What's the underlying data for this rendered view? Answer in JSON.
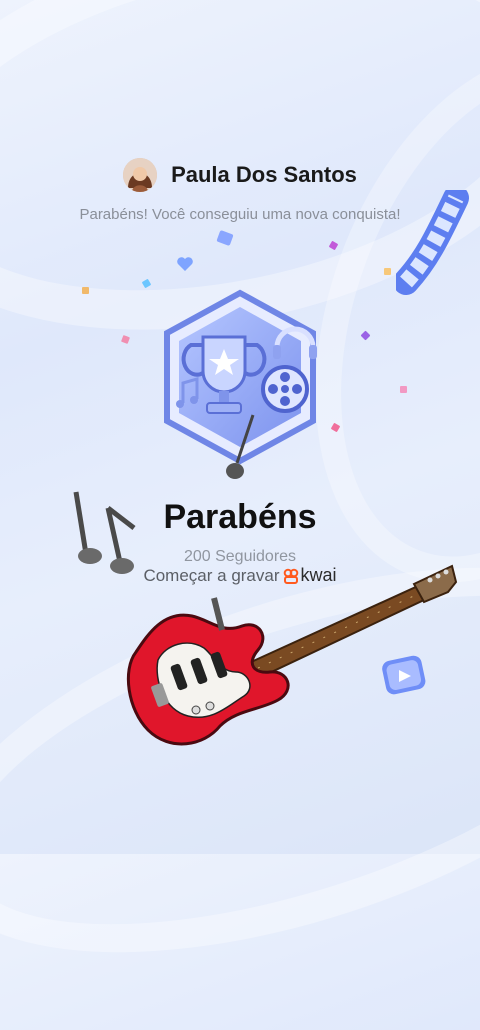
{
  "header": {
    "username": "Paula Dos Santos",
    "avatar_icon": "avatar"
  },
  "subtitle": "Parabéns! Você conseguiu uma nova conquista!",
  "achievement": {
    "title": "Parabéns",
    "followers": "200 Seguidores",
    "badge_icon": "trophy-film-badge-icon"
  },
  "cta": {
    "record_label": "Começar a gravar",
    "brand": "kwai",
    "brand_color": "#ff5a1f"
  },
  "decorations": {
    "guitar_icon": "electric-guitar-icon",
    "notes_icon": "music-notes-icon",
    "film_icon": "film-strip-icon",
    "play_icon": "play-button-icon"
  },
  "colors": {
    "badge_fill": "#8fa7f2",
    "badge_border": "#6f86e6",
    "guitar_red": "#e0162b"
  }
}
